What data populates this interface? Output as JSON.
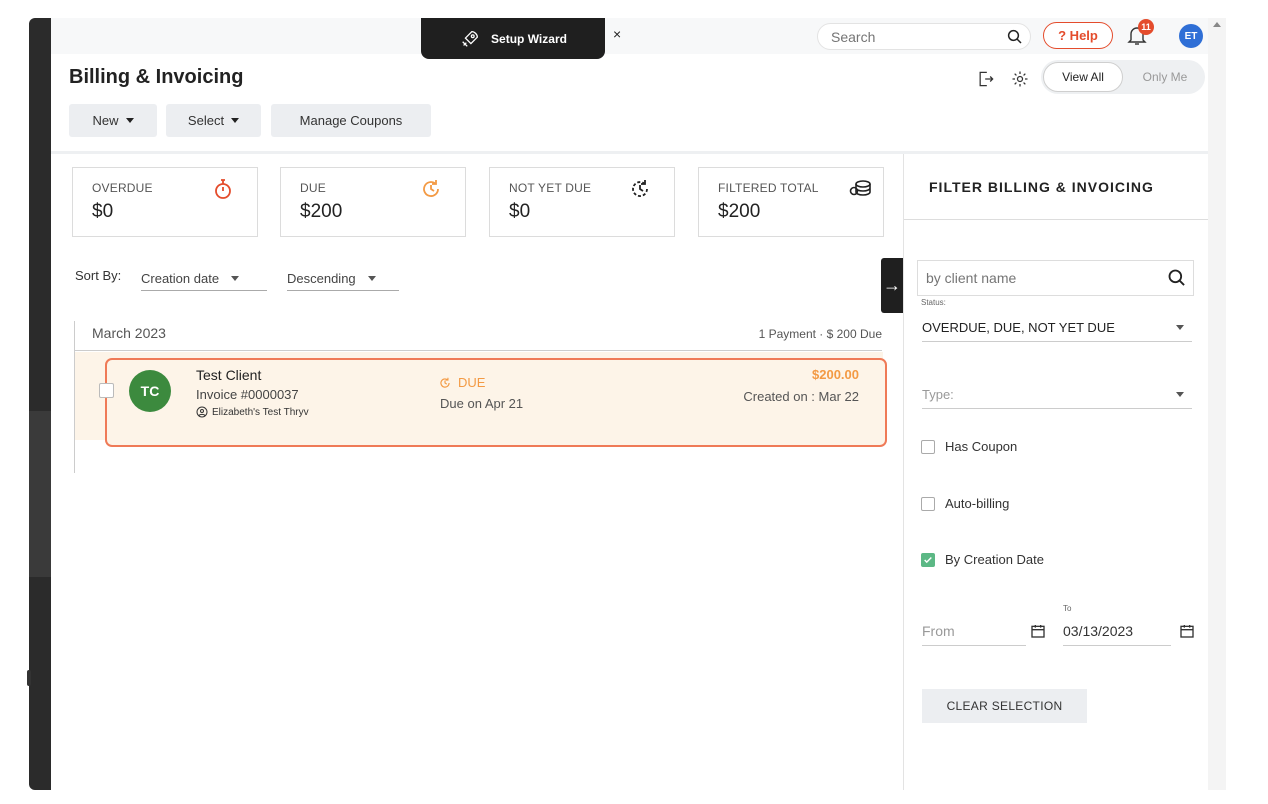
{
  "topbar": {
    "wizard_label": "Setup Wizard",
    "wizard_close": "×",
    "search_placeholder": "Search",
    "help_label": "? Help",
    "notification_count": "11",
    "user_initials": "ET"
  },
  "header": {
    "title": "Billing & Invoicing",
    "new_label": "New",
    "select_label": "Select",
    "manage_coupons_label": "Manage Coupons",
    "view_all": "View All",
    "only_me": "Only Me"
  },
  "summary": [
    {
      "label": "OVERDUE",
      "value": "$0",
      "icon": "stopwatch-icon",
      "color": "#e44c2c"
    },
    {
      "label": "DUE",
      "value": "$200",
      "icon": "clock-rotate-icon",
      "color": "#f39a44"
    },
    {
      "label": "NOT YET DUE",
      "value": "$0",
      "icon": "clock-pending-icon",
      "color": "#222222"
    },
    {
      "label": "FILTERED TOTAL",
      "value": "$200",
      "icon": "coins-icon",
      "color": "#222222"
    }
  ],
  "sort": {
    "label": "Sort By:",
    "field": "Creation date",
    "order": "Descending"
  },
  "group": {
    "month": "March 2023",
    "meta": "1 Payment  ·  $ 200 Due"
  },
  "invoice": {
    "initials": "TC",
    "client": "Test Client",
    "number": "Invoice #0000037",
    "owner": "Elizabeth's Test Thryv",
    "status": "DUE",
    "due_on": "Due on Apr 21",
    "amount": "$200.00",
    "created": "Created on : Mar 22"
  },
  "filter": {
    "title": "FILTER BILLING & INVOICING",
    "client_placeholder": "by client name",
    "status_label": "Status:",
    "status_value": "OVERDUE, DUE, NOT YET DUE",
    "type_placeholder": "Type:",
    "has_coupon": "Has Coupon",
    "auto_billing": "Auto-billing",
    "by_creation_date": "By Creation Date",
    "to_label": "To",
    "from_placeholder": "From",
    "to_value": "03/13/2023",
    "clear_label": "CLEAR SELECTION"
  },
  "colors": {
    "accent": "#e44c2c",
    "due": "#f39a44",
    "check": "#5cb885",
    "avatar": "#3c8a3e"
  }
}
